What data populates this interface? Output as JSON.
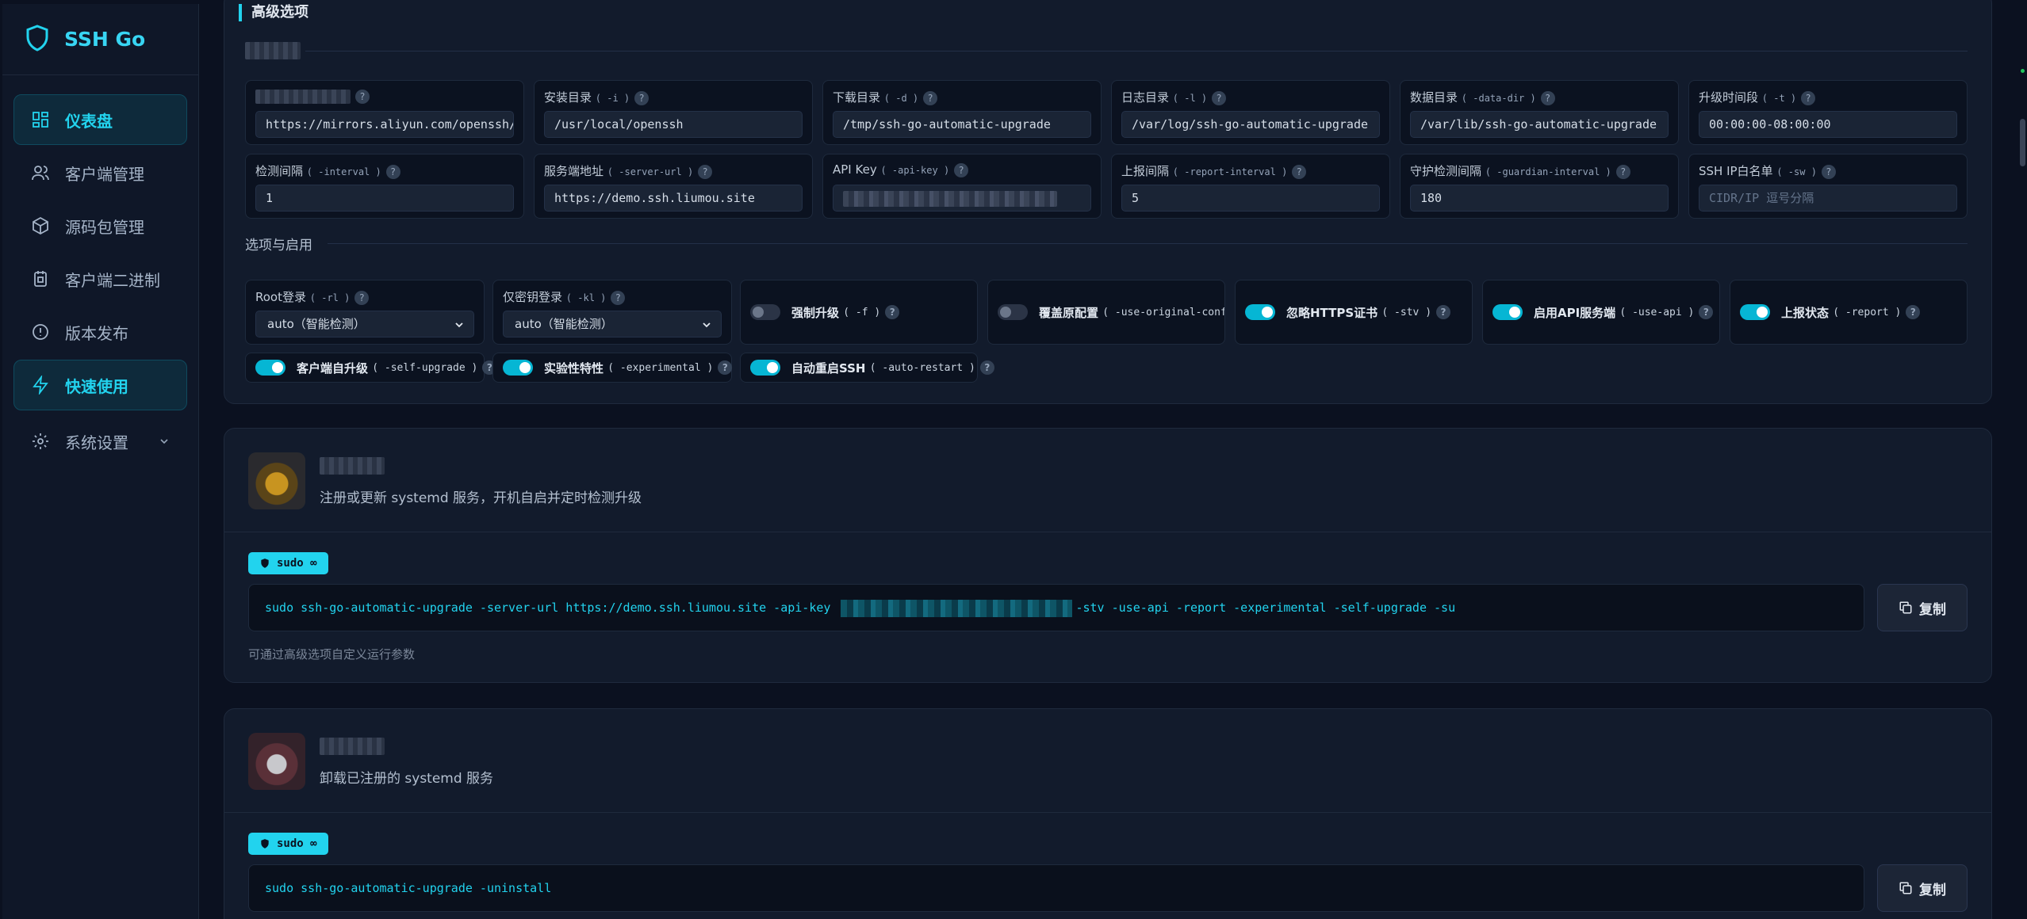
{
  "brand": {
    "name": "SSH Go",
    "accent": "#22d3ee"
  },
  "nav": [
    {
      "label": "仪表盘",
      "icon": "dashboard-icon",
      "active": true
    },
    {
      "label": "客户端管理",
      "icon": "users-icon",
      "active": false
    },
    {
      "label": "源码包管理",
      "icon": "package-icon",
      "active": false
    },
    {
      "label": "客户端二进制",
      "icon": "binary-icon",
      "active": false
    },
    {
      "label": "版本发布",
      "icon": "release-icon",
      "active": false
    },
    {
      "label": "快速使用",
      "icon": "lightning-icon",
      "active": true
    },
    {
      "label": "系统设置",
      "icon": "gear-icon",
      "active": false
    }
  ],
  "advanced": {
    "title": "高级选项",
    "fields": [
      {
        "label": "",
        "flag": "",
        "value": "https://mirrors.aliyun.com/openssh/por",
        "placeholder": ""
      },
      {
        "label": "安装目录",
        "flag": "( -i )",
        "value": "/usr/local/openssh"
      },
      {
        "label": "下载目录",
        "flag": "( -d )",
        "value": "/tmp/ssh-go-automatic-upgrade"
      },
      {
        "label": "日志目录",
        "flag": "( -l )",
        "value": "/var/log/ssh-go-automatic-upgrade"
      },
      {
        "label": "数据目录",
        "flag": "( -data-dir )",
        "value": "/var/lib/ssh-go-automatic-upgrade"
      },
      {
        "label": "升级时间段",
        "flag": "( -t )",
        "value": "00:00:00-08:00:00"
      },
      {
        "label": "检测间隔",
        "flag": "( -interval )",
        "value": "1"
      },
      {
        "label": "服务端地址",
        "flag": "( -server-url )",
        "value": "https://demo.ssh.liumou.site"
      },
      {
        "label": "API Key",
        "flag": "( -api-key )",
        "value": ""
      },
      {
        "label": "上报间隔",
        "flag": "( -report-interval )",
        "value": "5"
      },
      {
        "label": "守护检测间隔",
        "flag": "( -guardian-interval )",
        "value": "180"
      },
      {
        "label": "SSH IP白名单",
        "flag": "( -sw )",
        "value": "",
        "placeholder": "CIDR/IP 逗号分隔"
      }
    ],
    "options_title": "选项与启用",
    "selects": [
      {
        "label": "Root登录",
        "flag": "( -rl )",
        "value": "auto（智能检测）"
      },
      {
        "label": "仅密钥登录",
        "flag": "( -kl )",
        "value": "auto（智能检测）"
      }
    ],
    "toggles": [
      {
        "label": "强制升级",
        "flag": "( -f )",
        "on": false
      },
      {
        "label": "覆盖原配置",
        "flag": "( -use-original-config",
        "on": false
      },
      {
        "label": "忽略HTTPS证书",
        "flag": "( -stv )",
        "on": true
      },
      {
        "label": "启用API服务端",
        "flag": "( -use-api )",
        "on": true
      },
      {
        "label": "上报状态",
        "flag": "( -report )",
        "on": true
      },
      {
        "label": "客户端自升级",
        "flag": "( -self-upgrade )",
        "on": true
      },
      {
        "label": "实验性特性",
        "flag": "( -experimental )",
        "on": true
      },
      {
        "label": "自动重启SSH",
        "flag": "( -auto-restart )",
        "on": true
      }
    ]
  },
  "install": {
    "description": "注册或更新 systemd 服务，开机自启并定时检测升级",
    "badge": "sudo ∞",
    "cmd_prefix": "sudo ssh-go-automatic-upgrade -server-url https://demo.ssh.liumou.site -api-key ",
    "cmd_suffix": "-stv -use-api -report -experimental -self-upgrade -su",
    "copy_label": "复制",
    "hint": "可通过高级选项自定义运行参数"
  },
  "uninstall": {
    "description": "卸载已注册的 systemd 服务",
    "badge": "sudo ∞",
    "command": "sudo ssh-go-automatic-upgrade -uninstall",
    "copy_label": "复制"
  }
}
